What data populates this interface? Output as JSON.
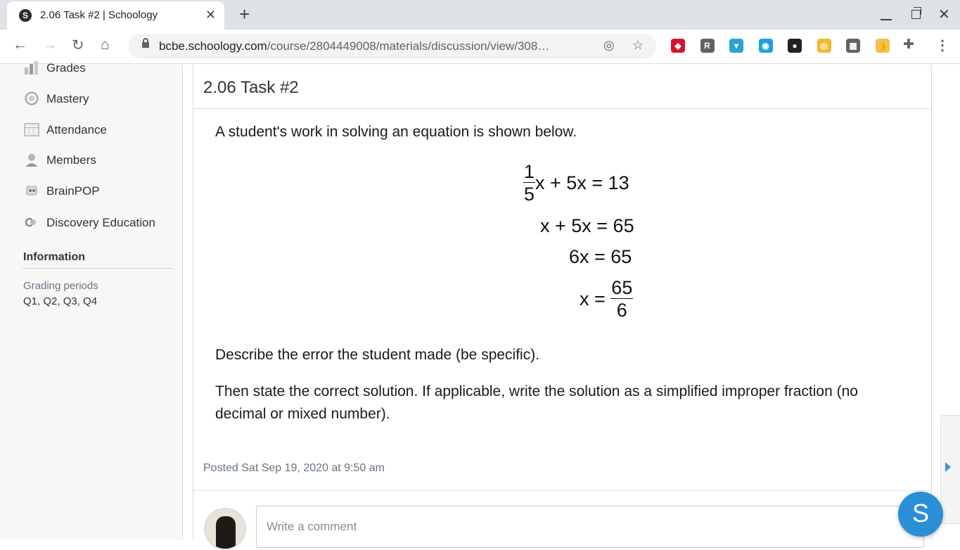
{
  "browser": {
    "tab_title": "2.06 Task #2 | Schoology",
    "favicon_letter": "S",
    "new_tab": "+",
    "url_host": "bcbe.schoology.com",
    "url_path": "/course/2804449008/materials/discussion/view/308…"
  },
  "extensions": [
    {
      "name": "ruby-icon",
      "color": "#d5142b",
      "glyph": "◆"
    },
    {
      "name": "r-icon",
      "color": "#5f6368",
      "glyph": "R"
    },
    {
      "name": "person-badge-icon",
      "color": "#29a3d6",
      "glyph": "▾"
    },
    {
      "name": "shield-circle-icon",
      "color": "#1ba1e2",
      "glyph": "◉"
    },
    {
      "name": "ninja-icon",
      "color": "#202124",
      "glyph": "●"
    },
    {
      "name": "coin-icon",
      "color": "#f5b82e",
      "glyph": "◎"
    },
    {
      "name": "grid-icon",
      "color": "#5f6368",
      "glyph": "▦"
    },
    {
      "name": "thumbs-up-icon",
      "color": "#f2c14e",
      "glyph": "👍"
    }
  ],
  "sidebar": {
    "items": [
      {
        "label": "Grades"
      },
      {
        "label": "Mastery"
      },
      {
        "label": "Attendance"
      },
      {
        "label": "Members"
      },
      {
        "label": "BrainPOP"
      },
      {
        "label": "Discovery Education"
      }
    ],
    "info_heading": "Information",
    "grading_label": "Grading periods",
    "grading_value": "Q1, Q2, Q3, Q4"
  },
  "main": {
    "title": "2.06 Task #2",
    "intro": "A student's work in solving an equation is shown below.",
    "math": {
      "line1_num": "1",
      "line1_den": "5",
      "line1_rest": "x + 5x = 13",
      "line2": "x + 5x = 65",
      "line3": "6x = 65",
      "line4_lhs": "x =",
      "line4_num": "65",
      "line4_den": "6"
    },
    "prompt1": "Describe the error the student made (be specific).",
    "prompt2_line1": "Then state the correct solution.  If applicable, write the solution as a simplified improper fraction (no",
    "prompt2_line2": "decimal or mixed number).",
    "posted": "Posted Sat Sep 19, 2020 at 9:50 am",
    "comment_placeholder": "Write a comment"
  },
  "fab_letter": "S"
}
